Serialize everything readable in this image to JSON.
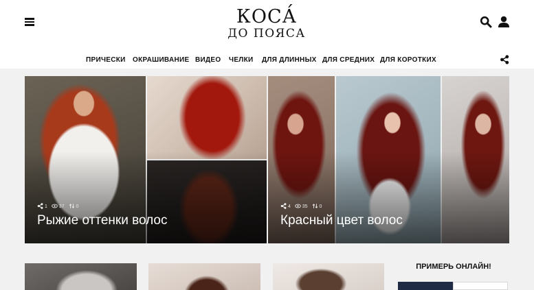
{
  "header": {
    "logo_line1": "КОСА́",
    "logo_line2": "ДО ПОЯСА",
    "icons": [
      "hamburger-menu-icon",
      "search-icon",
      "user-icon",
      "share-icon"
    ]
  },
  "nav": {
    "items": [
      {
        "label": "ПРИЧЕСКИ"
      },
      {
        "label": "ОКРАШИВАНИЕ"
      },
      {
        "label": "ВИДЕО"
      },
      {
        "label": "ЧЕЛКИ"
      },
      {
        "label": "ДЛЯ ДЛИННЫХ"
      },
      {
        "label": "ДЛЯ СРЕДНИХ"
      },
      {
        "label": "ДЛЯ КОРОТКИХ"
      }
    ]
  },
  "featured": [
    {
      "title": "Рыжие оттенки волос",
      "shares": "1",
      "views": "37",
      "reposts": "0"
    },
    {
      "title": "Красный цвет волос",
      "shares": "4",
      "views": "35",
      "reposts": "0"
    }
  ],
  "sidebar": {
    "title": "ПРИМЕРЬ ОНЛАЙН!"
  },
  "colors": {
    "background": "#f1f1f1",
    "header": "#ffffff",
    "text": "#111111",
    "overlay_text": "#ffffff"
  }
}
